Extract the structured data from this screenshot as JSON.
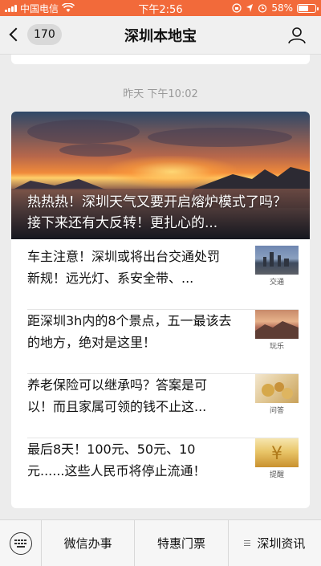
{
  "status_bar": {
    "carrier": "中国电信",
    "time": "下午2:56",
    "battery": "58%",
    "battery_level": 0.58
  },
  "nav": {
    "unread_count": "170",
    "title": "深圳本地宝"
  },
  "chat": {
    "timestamp": "昨天 下午10:02",
    "cover_title": "热热热！深圳天气又要开启熔炉模式了吗？接下来还有大反转！更扎心的...",
    "items": [
      {
        "text": "车主注意！深圳或将出台交通处罚新规！远光灯、系安全带、...",
        "thumb_caption": "交通"
      },
      {
        "text": "距深圳3h内的8个景点，五一最该去的地方，绝对是这里！",
        "thumb_caption": "玩乐"
      },
      {
        "text": "养老保险可以继承吗？答案是可以！而且家属可领的钱不止这...",
        "thumb_caption": "问答"
      },
      {
        "text": "最后8天！100元、50元、10元......这些人民币将停止流通！",
        "thumb_caption": "提醒"
      }
    ]
  },
  "bottom_menu": {
    "items": [
      "微信办事",
      "特惠门票",
      "深圳资讯"
    ]
  },
  "colors": {
    "status_bar": "#f26a3a",
    "nav_bg": "#f0f0f0",
    "chat_bg": "#ececec",
    "card_bg": "#ffffff"
  }
}
